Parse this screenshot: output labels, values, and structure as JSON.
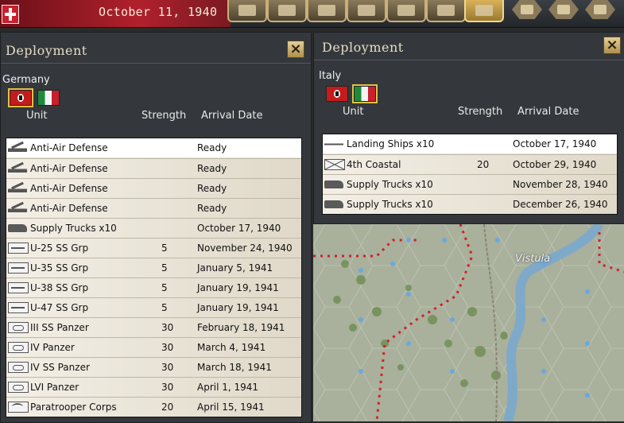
{
  "topbar": {
    "date": "October 11, 1940",
    "buttons": [
      "calendar-icon",
      "building-icon",
      "research-icon",
      "flag-icon",
      "document-icon",
      "binoculars-icon",
      "helmet-icon"
    ],
    "hex_buttons": [
      "unit-hex-icon",
      "grid-hex-icon",
      "tank-hex-icon"
    ]
  },
  "left_panel": {
    "title": "Deployment",
    "nation": "Germany",
    "headers": {
      "unit": "Unit",
      "strength": "Strength",
      "arrival": "Arrival Date"
    },
    "rows": [
      {
        "icon": "anti-air",
        "name": "Anti-Air Defense",
        "strength": "",
        "arrival": "Ready"
      },
      {
        "icon": "anti-air",
        "name": "Anti-Air Defense",
        "strength": "",
        "arrival": "Ready"
      },
      {
        "icon": "anti-air",
        "name": "Anti-Air Defense",
        "strength": "",
        "arrival": "Ready"
      },
      {
        "icon": "anti-air",
        "name": "Anti-Air Defense",
        "strength": "",
        "arrival": "Ready"
      },
      {
        "icon": "truck",
        "name": "Supply Trucks x10",
        "strength": "",
        "arrival": "October 17, 1940"
      },
      {
        "icon": "submarine",
        "name": "U-25 SS Grp",
        "strength": "5",
        "arrival": "November 24, 1940"
      },
      {
        "icon": "submarine",
        "name": "U-35 SS Grp",
        "strength": "5",
        "arrival": "January 5, 1941"
      },
      {
        "icon": "submarine",
        "name": "U-38 SS Grp",
        "strength": "5",
        "arrival": "January 19, 1941"
      },
      {
        "icon": "submarine",
        "name": "U-47 SS Grp",
        "strength": "5",
        "arrival": "January 19, 1941"
      },
      {
        "icon": "panzer",
        "name": "III SS Panzer",
        "strength": "30",
        "arrival": "February 18, 1941"
      },
      {
        "icon": "panzer",
        "name": "IV Panzer",
        "strength": "30",
        "arrival": "March 4, 1941"
      },
      {
        "icon": "panzer",
        "name": "IV SS Panzer",
        "strength": "30",
        "arrival": "March 18, 1941"
      },
      {
        "icon": "panzer",
        "name": "LVI Panzer",
        "strength": "30",
        "arrival": "April 1, 1941"
      },
      {
        "icon": "paratrooper",
        "name": "Paratrooper Corps",
        "strength": "20",
        "arrival": "April 15, 1941"
      }
    ]
  },
  "right_panel": {
    "title": "Deployment",
    "nation": "Italy",
    "headers": {
      "unit": "Unit",
      "strength": "Strength",
      "arrival": "Arrival Date"
    },
    "rows": [
      {
        "icon": "ship",
        "name": "Landing Ships x10",
        "strength": "",
        "arrival": "October 17, 1940"
      },
      {
        "icon": "coastal",
        "name": "4th Coastal",
        "strength": "20",
        "arrival": "October 29, 1940"
      },
      {
        "icon": "truck",
        "name": "Supply Trucks x10",
        "strength": "",
        "arrival": "November 28, 1940"
      },
      {
        "icon": "truck",
        "name": "Supply Trucks x10",
        "strength": "",
        "arrival": "December 26, 1940"
      }
    ]
  },
  "map": {
    "river_label": "Vistula"
  },
  "colors": {
    "accent": "#e2c04a",
    "list_bg": "#e9e4d9",
    "panel_bg": "#34383c",
    "border_red": "#d0202a",
    "river": "#7fa9c8"
  }
}
